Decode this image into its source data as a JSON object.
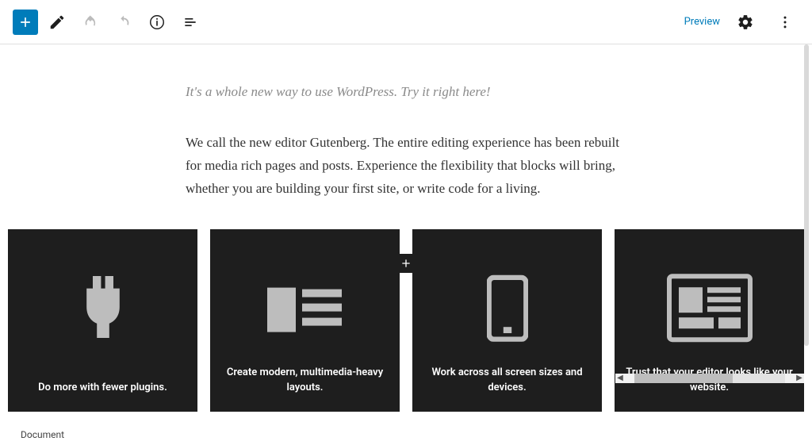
{
  "toolbar": {
    "preview_label": "Preview"
  },
  "content": {
    "intro_italic": "It's a whole new way to use WordPress. Try it right here!",
    "intro_body": "We call the new editor Gutenberg. The entire editing experience has been rebuilt for media rich pages and posts. Experience the flexibility that blocks will bring, whether you are building your first site, or write code for a living."
  },
  "cards": [
    {
      "label": "Do more with fewer plugins."
    },
    {
      "label": "Create modern, multimedia-heavy layouts."
    },
    {
      "label": "Work across all screen sizes and devices."
    },
    {
      "label": "Trust that your editor looks like your website."
    }
  ],
  "footer": {
    "tab": "Document"
  }
}
